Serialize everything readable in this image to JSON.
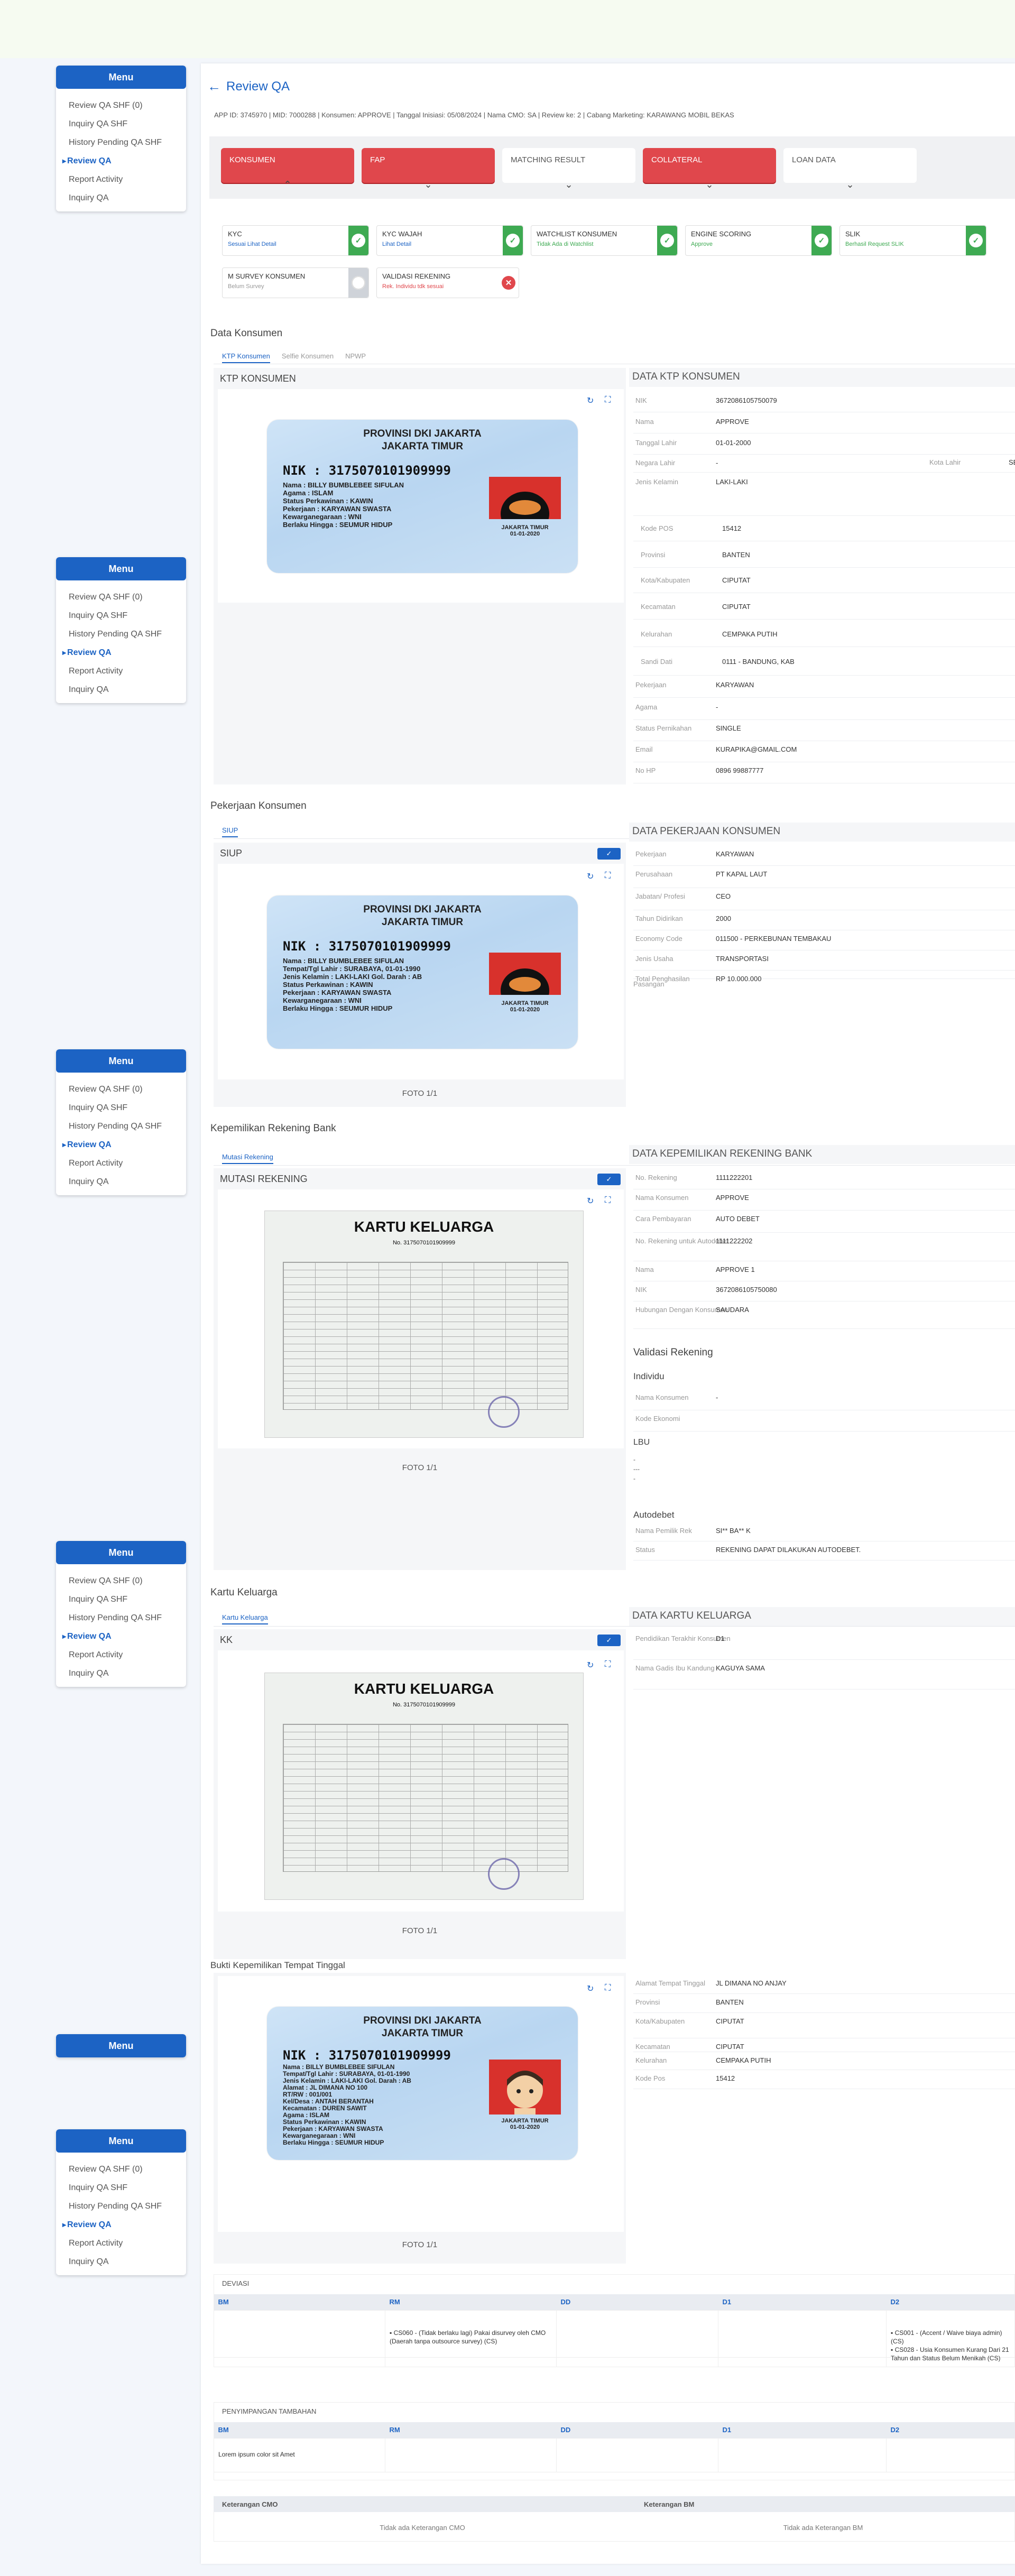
{
  "menu": {
    "title": "Menu",
    "items": [
      "Review QA SHF (0)",
      "Inquiry QA SHF",
      "History Pending QA SHF",
      "Review QA",
      "Report Activity",
      "Inquiry QA"
    ]
  },
  "page": {
    "title": "Review QA",
    "info": "APP ID: 3745970 | MID: 7000288 | Konsumen: APPROVE | Tanggal Inisiasi: 05/08/2024 | Nama CMO: SA | Review ke: 2 | Cabang Marketing: KARAWANG MOBIL BEKAS"
  },
  "stage_tabs": [
    "KONSUMEN",
    "FAP",
    "MATCHING RESULT",
    "COLLATERAL",
    "LOAN DATA"
  ],
  "kyc": [
    {
      "title": "KYC",
      "sub": "Sesuai Lihat Detail"
    },
    {
      "title": "KYC WAJAH",
      "sub": "Lihat Detail"
    },
    {
      "title": "WATCHLIST KONSUMEN",
      "sub": "Tidak Ada di Watchlist"
    },
    {
      "title": "ENGINE SCORING",
      "sub": "Approve"
    },
    {
      "title": "SLIK",
      "sub": "Berhasil Request SLIK"
    },
    {
      "title": "M SURVEY KONSUMEN",
      "sub": "Belum Survey"
    },
    {
      "title": "VALIDASI REKENING",
      "sub": "Rek. Individu tdk sesuai"
    }
  ],
  "s1": {
    "head": "Data Konsumen",
    "tabs": [
      "KTP Konsumen",
      "Selfie Konsumen",
      "NPWP"
    ],
    "card": "KTP KONSUMEN",
    "data_title": "DATA KTP KONSUMEN",
    "fields": [
      [
        "NIK",
        "3672086105750079"
      ],
      [
        "Nama",
        "APPROVE"
      ],
      [
        "Tanggal Lahir",
        "01-01-2000"
      ],
      [
        "Negara Lahir",
        "-"
      ],
      [
        "Jenis Kelamin",
        "LAKI-LAKI"
      ],
      [
        "Kode POS",
        "15412"
      ],
      [
        "Provinsi",
        "BANTEN"
      ],
      [
        "Kota/Kabupaten",
        "CIPUTAT"
      ],
      [
        "Kecamatan",
        "CIPUTAT"
      ],
      [
        "Kelurahan",
        "CEMPAKA PUTIH"
      ],
      [
        "Sandi Dati",
        "0111 - BANDUNG, KAB"
      ],
      [
        "Pekerjaan",
        "KARYAWAN"
      ],
      [
        "Agama",
        "-"
      ],
      [
        "Status Pernikahan",
        "SINGLE"
      ],
      [
        "Email",
        "KURAPIKA@GMAIL.COM"
      ],
      [
        "No HP",
        "0896 99887777"
      ]
    ],
    "kota_lahir_label": "Kota Lahir",
    "kota_lahir_val": "SE"
  },
  "ktp": {
    "prov": "PROVINSI DKI JAKARTA",
    "city": "JAKARTA TIMUR",
    "nik_label": "NIK",
    "nik": ": 3175070101909999",
    "lines1": [
      "Nama : BILLY BUMBLEBEE SIFULAN",
      "Agama : ISLAM",
      "Status Perkawinan : KAWIN",
      "Pekerjaan : KARYAWAN SWASTA",
      "Kewarganegaraan : WNI",
      "Berlaku Hingga : SEUMUR HIDUP"
    ],
    "lines2": [
      "Nama : BILLY BUMBLEBEE SIFULAN",
      "Tempat/Tgl Lahir : SURABAYA, 01-01-1990",
      "Jenis Kelamin : LAKI-LAKI   Gol. Darah : AB",
      "Status Perkawinan : KAWIN",
      "Pekerjaan : KARYAWAN SWASTA",
      "Kewarganegaraan : WNI",
      "Berlaku Hingga : SEUMUR HIDUP"
    ],
    "lines3": [
      "Nama : BILLY BUMBLEBEE SIFULAN",
      "Tempat/Tgl Lahir : SURABAYA, 01-01-1990",
      "Jenis Kelamin : LAKI-LAKI   Gol. Darah : AB",
      "Alamat : JL DIMANA NO 100",
      "RT/RW : 001/001",
      "Kel/Desa : ANTAH BERANTAH",
      "Kecamatan : DUREN SAWIT",
      "Agama : ISLAM",
      "Status Perkawinan : KAWIN",
      "Pekerjaan : KARYAWAN SWASTA",
      "Kewarganegaraan : WNI",
      "Berlaku Hingga : SEUMUR HIDUP"
    ],
    "plate": "JAKARTA TIMUR",
    "plate_date": "01-01-2020"
  },
  "s2": {
    "head": "Pekerjaan Konsumen",
    "tab": "SIUP",
    "card": "SIUP",
    "data_title": "DATA PEKERJAAN KONSUMEN",
    "foto": "FOTO 1/1",
    "fields": [
      [
        "Pekerjaan",
        "KARYAWAN"
      ],
      [
        "Perusahaan",
        "PT KAPAL LAUT"
      ],
      [
        "Jabatan/ Profesi",
        "CEO"
      ],
      [
        "Tahun Didirikan",
        "2000"
      ],
      [
        "Economy Code",
        "011500 - PERKEBUNAN TEMBAKAU"
      ],
      [
        "Jenis Usaha",
        "TRANSPORTASI"
      ],
      [
        "Total Penghasilan",
        "RP 10.000.000"
      ]
    ],
    "pasangan": "Pasangan"
  },
  "s3": {
    "head": "Kepemilikan Rekening Bank",
    "tab": "Mutasi Rekening",
    "card": "MUTASI REKENING",
    "data_title": "DATA KEPEMILIKAN REKENING BANK",
    "foto": "FOTO 1/1",
    "fields": [
      [
        "No. Rekening",
        "1111222201"
      ],
      [
        "Nama Konsumen",
        "APPROVE"
      ],
      [
        "Cara Pembayaran",
        "AUTO DEBET"
      ],
      [
        "No. Rekening untuk Autodebet",
        "1111222202"
      ],
      [
        "Nama",
        "APPROVE 1"
      ],
      [
        "NIK",
        "3672086105750080"
      ],
      [
        "Hubungan Dengan Konsumen",
        "SAUDARA"
      ]
    ],
    "validasi": "Validasi Rekening",
    "individu": "Individu",
    "ind_fields": [
      [
        "Nama Konsumen",
        "-"
      ],
      [
        "Kode Ekonomi",
        ""
      ]
    ],
    "lbu": "LBU",
    "lbu_vals": [
      "-",
      "---",
      "-"
    ],
    "autodebet": "Autodebet",
    "ad_fields": [
      [
        "Nama Pemilik Rek",
        "SI** BA** K"
      ],
      [
        "Status",
        "REKENING DAPAT DILAKUKAN AUTODEBET."
      ]
    ]
  },
  "kk": {
    "title": "KARTU KELUARGA",
    "no": "No. 3175070101909999"
  },
  "s4": {
    "head": "Kartu Keluarga",
    "tab": "Kartu Keluarga",
    "card": "KK",
    "data_title": "DATA KARTU KELUARGA",
    "foto": "FOTO 1/1",
    "fields": [
      [
        "Pendidikan Terakhir Konsumen",
        "D1"
      ],
      [
        "Nama Gadis Ibu Kandung",
        "KAGUYA SAMA"
      ]
    ]
  },
  "s5": {
    "head": "Bukti Kepemilikan Tempat Tinggal",
    "foto": "FOTO 1/1",
    "fields": [
      [
        "Alamat Tempat Tinggal",
        "JL DIMANA NO ANJAY"
      ],
      [
        "Provinsi",
        "BANTEN"
      ],
      [
        "Kota/Kabupaten",
        "CIPUTAT"
      ],
      [
        "Kecamatan",
        "CIPUTAT"
      ],
      [
        "Kelurahan",
        "CEMPAKA PUTIH"
      ],
      [
        "Kode Pos",
        "15412"
      ]
    ]
  },
  "deviasi": {
    "title": "DEVIASI",
    "cols": [
      "BM",
      "RM",
      "DD",
      "D1",
      "D2"
    ],
    "rm": "▪ CS060 - (Tidak berlaku lagi) Pakai disurvey oleh CMO (Daerah tanpa outsource survey) (CS)",
    "d2": [
      "▪ CS001 - (Accent / Waive biaya admin) (CS)",
      "▪ CS028 - Usia Konsumen Kurang Dari 21 Tahun dan Status Belum Menikah (CS)"
    ]
  },
  "penyimpangan": {
    "title": "PENYIMPANGAN TAMBAHAN",
    "cols": [
      "BM",
      "RM",
      "DD",
      "D1",
      "D2"
    ],
    "bm": "Lorem ipsum color sit Amet"
  },
  "keterangan": {
    "cmo_label": "Keterangan CMO",
    "bm_label": "Keterangan BM",
    "cmo_val": "Tidak ada Keterangan CMO",
    "bm_val": "Tidak ada Keterangan BM"
  },
  "colors": {
    "primary": "#1c63c4",
    "red": "#e0474c",
    "green": "#3eaa52"
  }
}
